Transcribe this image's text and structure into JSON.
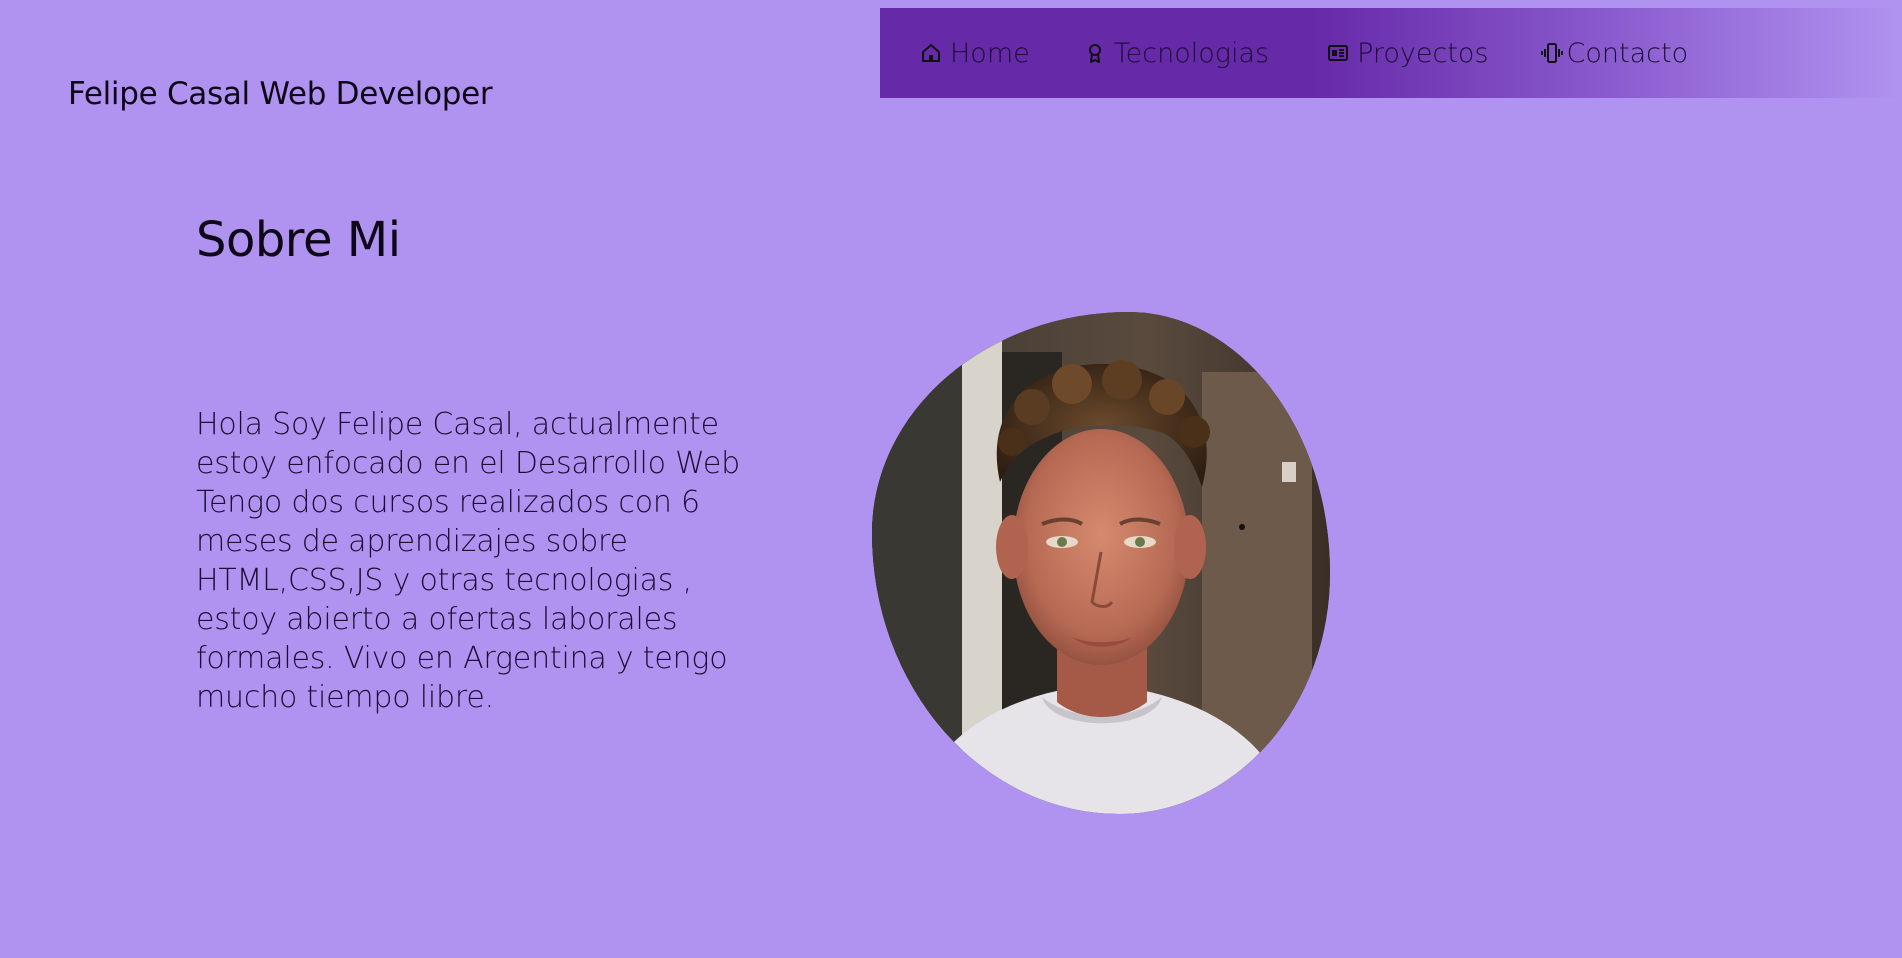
{
  "brand": {
    "title": "Felipe Casal Web Developer"
  },
  "nav": {
    "items": [
      {
        "label": "Home",
        "icon": "home-icon"
      },
      {
        "label": "Tecnologias",
        "icon": "award-icon"
      },
      {
        "label": "Proyectos",
        "icon": "newspaper-icon"
      },
      {
        "label": "Contacto",
        "icon": "phone-vibrate-icon"
      }
    ]
  },
  "about": {
    "title": "Sobre Mi",
    "text": "Hola Soy Felipe Casal, actualmente estoy enfocado en el Desarrollo Web Tengo dos cursos realizados con 6 meses de aprendizajes sobre HTML,CSS,JS y otras tecnologias , estoy abierto a ofertas laborales formales. Vivo en Argentina y tengo mucho tiempo libre."
  },
  "colors": {
    "background": "#b093f0",
    "navbar": "#6629a8",
    "text": "#1b0d33"
  }
}
